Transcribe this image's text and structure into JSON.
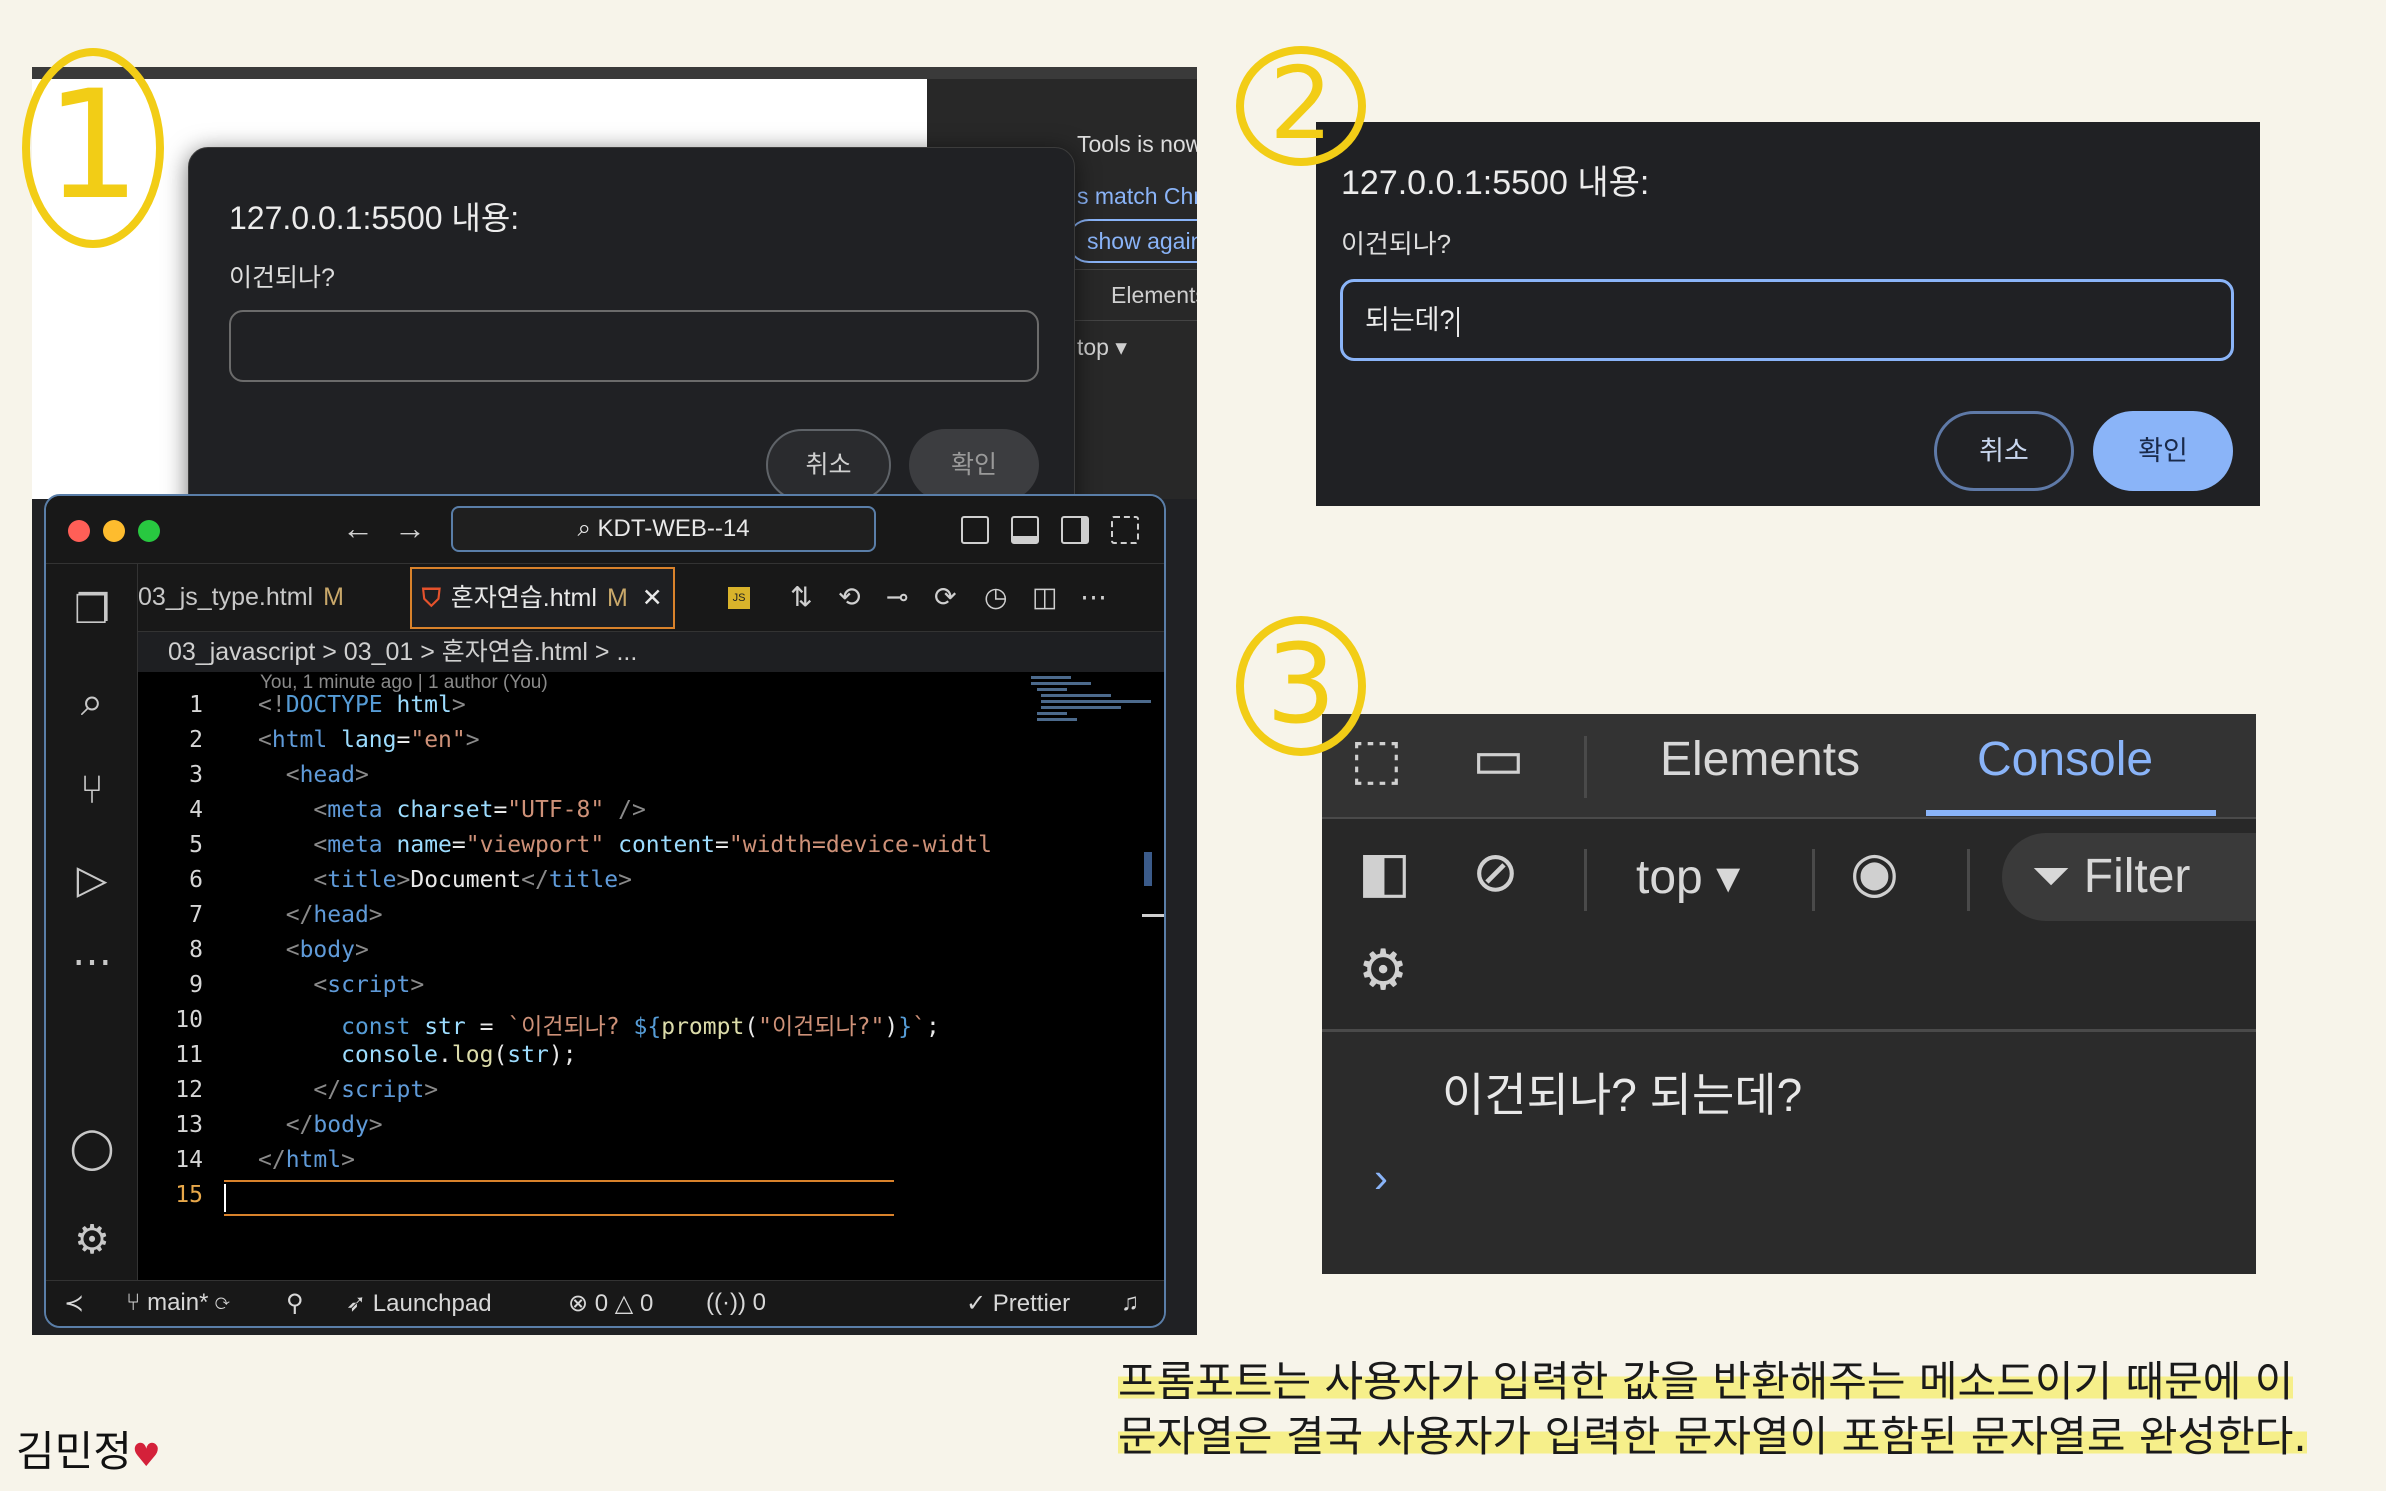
{
  "panel1": {
    "devtools_lines": [
      "Tools is now av",
      "s match Chrom"
    ],
    "devtools_pill": "show again",
    "devtools_tab": "Elements",
    "devtools_context": "top ▾",
    "dialog": {
      "title": "127.0.0.1:5500 내용:",
      "message": "이건되나?",
      "input_value": "",
      "cancel": "취소",
      "ok": "확인"
    },
    "vscode": {
      "search": "KDT-WEB--14",
      "tabs": [
        {
          "label": "03_js_type.html",
          "badge": "M"
        },
        {
          "label": "혼자연습.html",
          "badge": "M"
        }
      ],
      "breadcrumb": "03_javascript > 03_01 > 혼자연습.html > ...",
      "blame": "You, 1 minute ago | 1 author (You)",
      "line_numbers": [
        "1",
        "2",
        "3",
        "4",
        "5",
        "6",
        "7",
        "8",
        "9",
        "10",
        "11",
        "12",
        "13",
        "14",
        "15"
      ],
      "status": {
        "branch": "main*",
        "launchpad": "Launchpad",
        "problems": "0",
        "warnings": "0",
        "ports": "0",
        "prettier": "✓ Prettier"
      }
    }
  },
  "panel2": {
    "title": "127.0.0.1:5500 내용:",
    "message": "이건되나?",
    "input_value": "되는데?",
    "cancel": "취소",
    "ok": "확인"
  },
  "panel3": {
    "tabs": [
      "Elements",
      "Console"
    ],
    "context": "top",
    "filter": "Filter",
    "output": "이건되나?  되는데?"
  },
  "annotations": {
    "numbers": [
      "1",
      "2",
      "3"
    ],
    "note_line1": "프롬포트는 사용자가 입력한 값을 반환해주는 메소드이기 때문에 이",
    "note_line2": "문자열은 결국 사용자가 입력한 문자열이 포함된 문자열로 완성한다.",
    "signature": "김민정",
    "highlight_color": "#f6ef8a",
    "circle_color": "#f2cd16"
  }
}
